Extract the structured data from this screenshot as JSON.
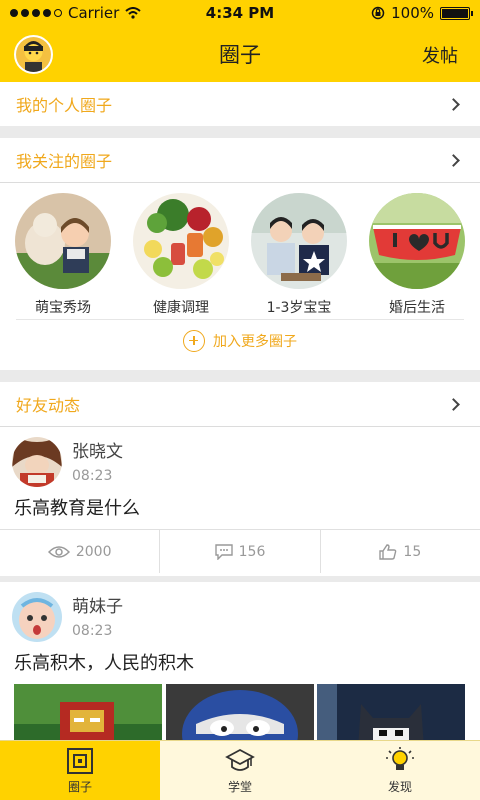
{
  "status": {
    "carrier": "Carrier",
    "time": "4:34 PM",
    "battery": "100%"
  },
  "nav": {
    "title": "圈子",
    "action": "发帖"
  },
  "my_circle": {
    "label": "我的个人圈子"
  },
  "followed": {
    "label": "我关注的圈子",
    "circles": [
      {
        "label": "萌宝秀场"
      },
      {
        "label": "健康调理"
      },
      {
        "label": "1-3岁宝宝"
      },
      {
        "label": "婚后生活"
      }
    ],
    "add_more": "加入更多圈子"
  },
  "friends": {
    "label": "好友动态",
    "posts": [
      {
        "name": "张晓文",
        "time": "08:23",
        "text": "乐高教育是什么",
        "views": "2000",
        "comments": "156",
        "likes": "15"
      },
      {
        "name": "萌妹子",
        "time": "08:23",
        "text": "乐高积木，人民的积木"
      }
    ]
  },
  "tabs": [
    {
      "label": "圈子",
      "icon": "circle-tab-icon",
      "active": true
    },
    {
      "label": "学堂",
      "icon": "graduation-cap-icon",
      "active": false
    },
    {
      "label": "发现",
      "icon": "lightbulb-icon",
      "active": false
    }
  ]
}
